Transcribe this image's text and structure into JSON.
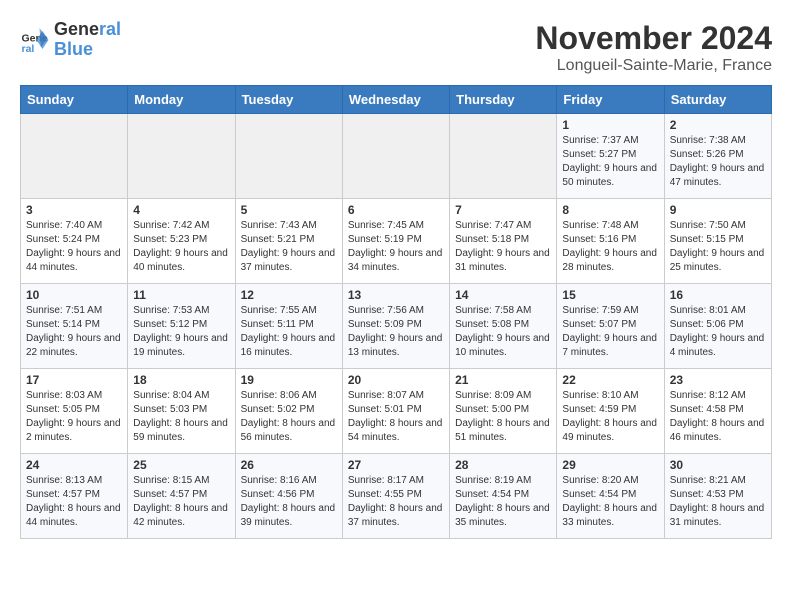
{
  "logo": {
    "line1": "General",
    "line2": "Blue"
  },
  "title": "November 2024",
  "location": "Longueil-Sainte-Marie, France",
  "weekdays": [
    "Sunday",
    "Monday",
    "Tuesday",
    "Wednesday",
    "Thursday",
    "Friday",
    "Saturday"
  ],
  "weeks": [
    [
      {
        "day": "",
        "sunrise": "",
        "sunset": "",
        "daylight": ""
      },
      {
        "day": "",
        "sunrise": "",
        "sunset": "",
        "daylight": ""
      },
      {
        "day": "",
        "sunrise": "",
        "sunset": "",
        "daylight": ""
      },
      {
        "day": "",
        "sunrise": "",
        "sunset": "",
        "daylight": ""
      },
      {
        "day": "",
        "sunrise": "",
        "sunset": "",
        "daylight": ""
      },
      {
        "day": "1",
        "sunrise": "Sunrise: 7:37 AM",
        "sunset": "Sunset: 5:27 PM",
        "daylight": "Daylight: 9 hours and 50 minutes."
      },
      {
        "day": "2",
        "sunrise": "Sunrise: 7:38 AM",
        "sunset": "Sunset: 5:26 PM",
        "daylight": "Daylight: 9 hours and 47 minutes."
      }
    ],
    [
      {
        "day": "3",
        "sunrise": "Sunrise: 7:40 AM",
        "sunset": "Sunset: 5:24 PM",
        "daylight": "Daylight: 9 hours and 44 minutes."
      },
      {
        "day": "4",
        "sunrise": "Sunrise: 7:42 AM",
        "sunset": "Sunset: 5:23 PM",
        "daylight": "Daylight: 9 hours and 40 minutes."
      },
      {
        "day": "5",
        "sunrise": "Sunrise: 7:43 AM",
        "sunset": "Sunset: 5:21 PM",
        "daylight": "Daylight: 9 hours and 37 minutes."
      },
      {
        "day": "6",
        "sunrise": "Sunrise: 7:45 AM",
        "sunset": "Sunset: 5:19 PM",
        "daylight": "Daylight: 9 hours and 34 minutes."
      },
      {
        "day": "7",
        "sunrise": "Sunrise: 7:47 AM",
        "sunset": "Sunset: 5:18 PM",
        "daylight": "Daylight: 9 hours and 31 minutes."
      },
      {
        "day": "8",
        "sunrise": "Sunrise: 7:48 AM",
        "sunset": "Sunset: 5:16 PM",
        "daylight": "Daylight: 9 hours and 28 minutes."
      },
      {
        "day": "9",
        "sunrise": "Sunrise: 7:50 AM",
        "sunset": "Sunset: 5:15 PM",
        "daylight": "Daylight: 9 hours and 25 minutes."
      }
    ],
    [
      {
        "day": "10",
        "sunrise": "Sunrise: 7:51 AM",
        "sunset": "Sunset: 5:14 PM",
        "daylight": "Daylight: 9 hours and 22 minutes."
      },
      {
        "day": "11",
        "sunrise": "Sunrise: 7:53 AM",
        "sunset": "Sunset: 5:12 PM",
        "daylight": "Daylight: 9 hours and 19 minutes."
      },
      {
        "day": "12",
        "sunrise": "Sunrise: 7:55 AM",
        "sunset": "Sunset: 5:11 PM",
        "daylight": "Daylight: 9 hours and 16 minutes."
      },
      {
        "day": "13",
        "sunrise": "Sunrise: 7:56 AM",
        "sunset": "Sunset: 5:09 PM",
        "daylight": "Daylight: 9 hours and 13 minutes."
      },
      {
        "day": "14",
        "sunrise": "Sunrise: 7:58 AM",
        "sunset": "Sunset: 5:08 PM",
        "daylight": "Daylight: 9 hours and 10 minutes."
      },
      {
        "day": "15",
        "sunrise": "Sunrise: 7:59 AM",
        "sunset": "Sunset: 5:07 PM",
        "daylight": "Daylight: 9 hours and 7 minutes."
      },
      {
        "day": "16",
        "sunrise": "Sunrise: 8:01 AM",
        "sunset": "Sunset: 5:06 PM",
        "daylight": "Daylight: 9 hours and 4 minutes."
      }
    ],
    [
      {
        "day": "17",
        "sunrise": "Sunrise: 8:03 AM",
        "sunset": "Sunset: 5:05 PM",
        "daylight": "Daylight: 9 hours and 2 minutes."
      },
      {
        "day": "18",
        "sunrise": "Sunrise: 8:04 AM",
        "sunset": "Sunset: 5:03 PM",
        "daylight": "Daylight: 8 hours and 59 minutes."
      },
      {
        "day": "19",
        "sunrise": "Sunrise: 8:06 AM",
        "sunset": "Sunset: 5:02 PM",
        "daylight": "Daylight: 8 hours and 56 minutes."
      },
      {
        "day": "20",
        "sunrise": "Sunrise: 8:07 AM",
        "sunset": "Sunset: 5:01 PM",
        "daylight": "Daylight: 8 hours and 54 minutes."
      },
      {
        "day": "21",
        "sunrise": "Sunrise: 8:09 AM",
        "sunset": "Sunset: 5:00 PM",
        "daylight": "Daylight: 8 hours and 51 minutes."
      },
      {
        "day": "22",
        "sunrise": "Sunrise: 8:10 AM",
        "sunset": "Sunset: 4:59 PM",
        "daylight": "Daylight: 8 hours and 49 minutes."
      },
      {
        "day": "23",
        "sunrise": "Sunrise: 8:12 AM",
        "sunset": "Sunset: 4:58 PM",
        "daylight": "Daylight: 8 hours and 46 minutes."
      }
    ],
    [
      {
        "day": "24",
        "sunrise": "Sunrise: 8:13 AM",
        "sunset": "Sunset: 4:57 PM",
        "daylight": "Daylight: 8 hours and 44 minutes."
      },
      {
        "day": "25",
        "sunrise": "Sunrise: 8:15 AM",
        "sunset": "Sunset: 4:57 PM",
        "daylight": "Daylight: 8 hours and 42 minutes."
      },
      {
        "day": "26",
        "sunrise": "Sunrise: 8:16 AM",
        "sunset": "Sunset: 4:56 PM",
        "daylight": "Daylight: 8 hours and 39 minutes."
      },
      {
        "day": "27",
        "sunrise": "Sunrise: 8:17 AM",
        "sunset": "Sunset: 4:55 PM",
        "daylight": "Daylight: 8 hours and 37 minutes."
      },
      {
        "day": "28",
        "sunrise": "Sunrise: 8:19 AM",
        "sunset": "Sunset: 4:54 PM",
        "daylight": "Daylight: 8 hours and 35 minutes."
      },
      {
        "day": "29",
        "sunrise": "Sunrise: 8:20 AM",
        "sunset": "Sunset: 4:54 PM",
        "daylight": "Daylight: 8 hours and 33 minutes."
      },
      {
        "day": "30",
        "sunrise": "Sunrise: 8:21 AM",
        "sunset": "Sunset: 4:53 PM",
        "daylight": "Daylight: 8 hours and 31 minutes."
      }
    ]
  ]
}
